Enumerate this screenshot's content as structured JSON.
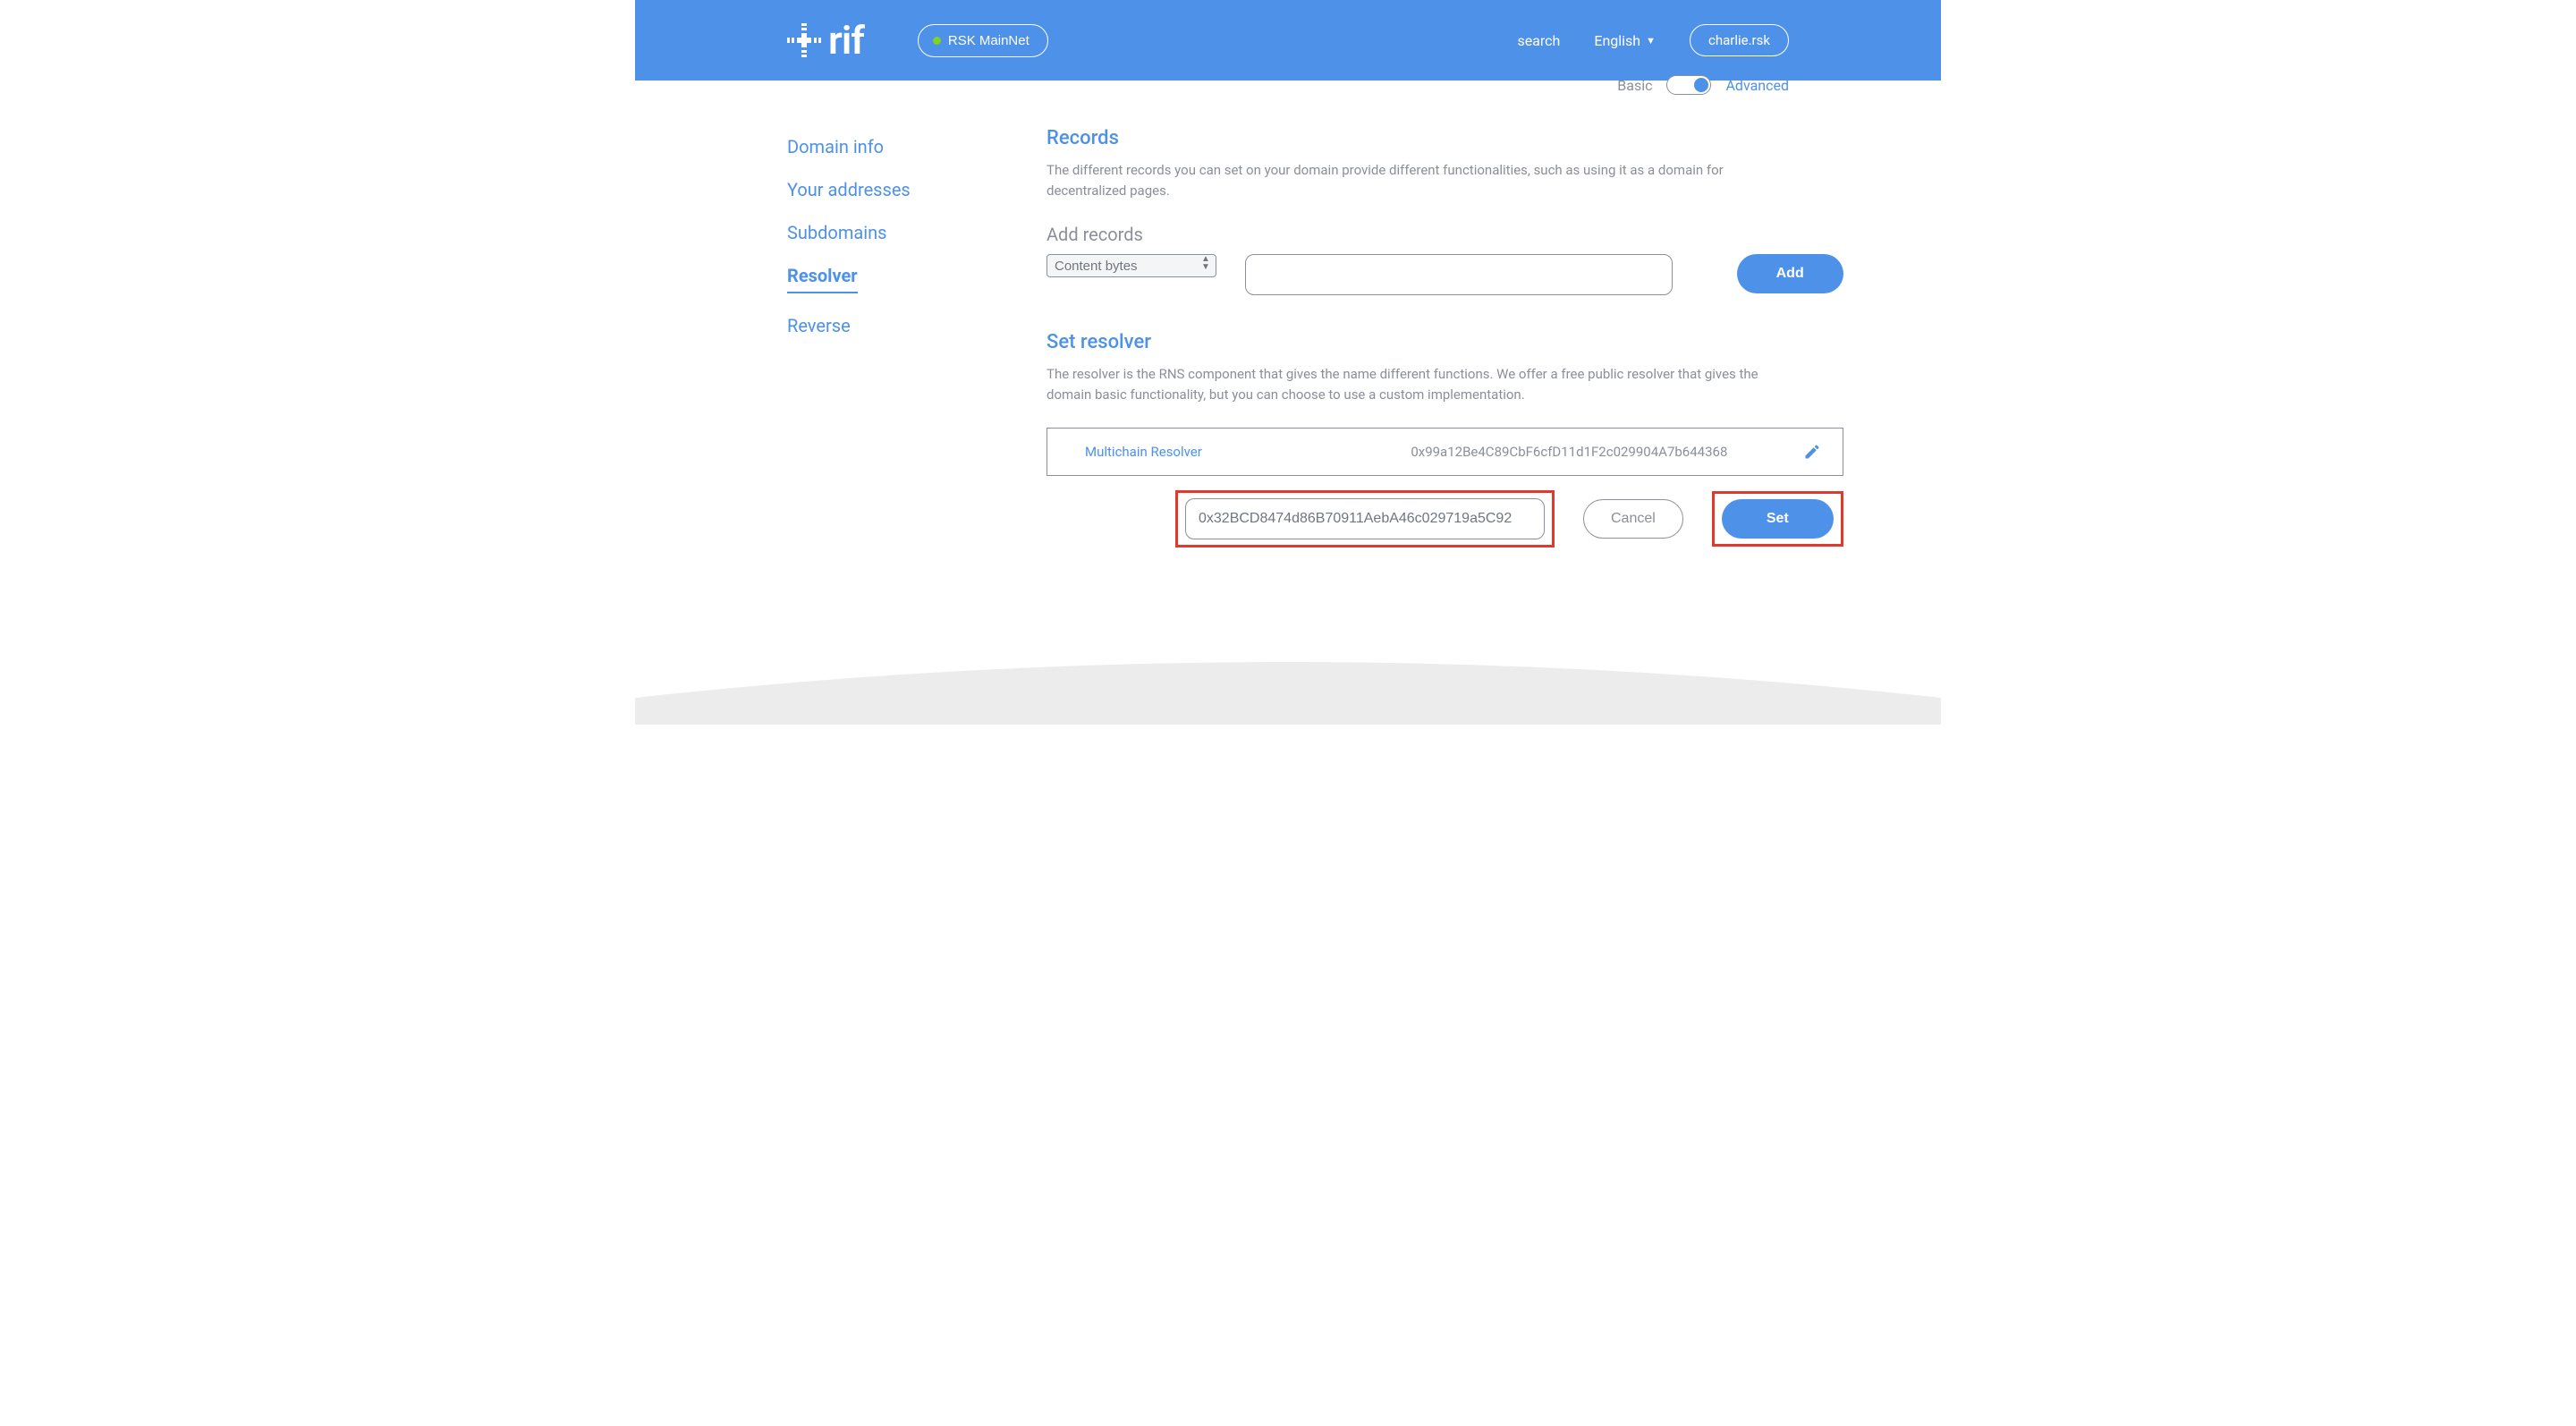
{
  "header": {
    "logo_text": "rif",
    "network_label": "RSK MainNet",
    "search_label": "search",
    "language_label": "English",
    "user_domain": "charlie.rsk"
  },
  "mode": {
    "basic_label": "Basic",
    "advanced_label": "Advanced"
  },
  "sidebar": {
    "items": [
      {
        "label": "Domain info"
      },
      {
        "label": "Your addresses"
      },
      {
        "label": "Subdomains"
      },
      {
        "label": "Resolver"
      },
      {
        "label": "Reverse"
      }
    ],
    "active_index": 3
  },
  "records": {
    "title": "Records",
    "description": "The different records you can set on your domain provide different functionalities, such as using it as a domain for decentralized pages.",
    "add_label": "Add records",
    "select_value": "Content bytes",
    "add_button": "Add"
  },
  "resolver": {
    "title": "Set resolver",
    "description": "The resolver is the RNS component that gives the name different functions. We offer a free public resolver that gives the domain basic functionality, but you can choose to use a custom implementation.",
    "current_name": "Multichain Resolver",
    "current_address": "0x99a12Be4C89CbF6cfD11d1F2c029904A7b644368",
    "input_value": "0x32BCD8474d86B70911AebA46c029719a5C92",
    "cancel_button": "Cancel",
    "set_button": "Set"
  }
}
